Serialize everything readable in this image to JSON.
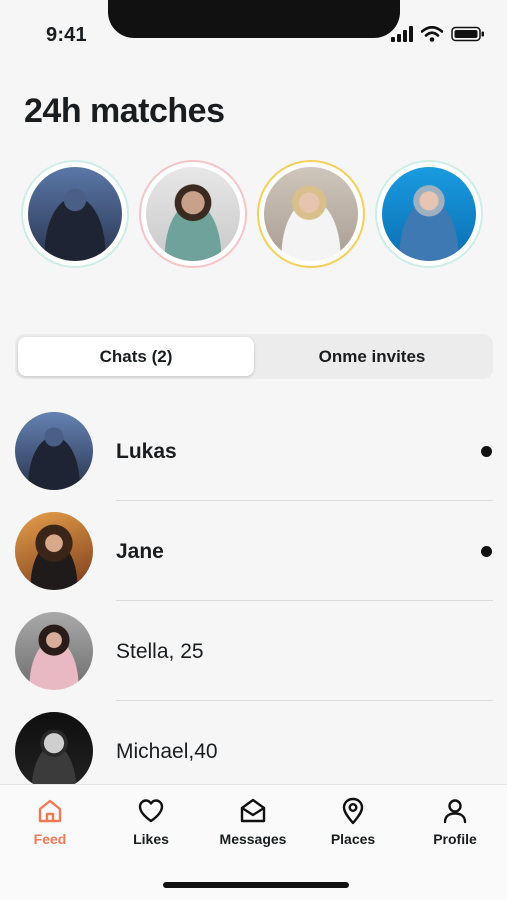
{
  "status": {
    "time": "9:41"
  },
  "title": "24h matches",
  "stories": [
    {
      "name": "story-1",
      "ring": "#cdeee6"
    },
    {
      "name": "story-2",
      "ring": "#f5c5c5"
    },
    {
      "name": "story-3",
      "ring": "#f6cf5a"
    },
    {
      "name": "story-4",
      "ring": "#cdeee6"
    }
  ],
  "tabs": {
    "chats": "Chats (2)",
    "invites": "Onme invites",
    "active": "chats"
  },
  "chats": [
    {
      "name": "Lukas",
      "unread": true
    },
    {
      "name": "Jane",
      "unread": true
    },
    {
      "name": "Stella, 25",
      "unread": false
    },
    {
      "name": "Michael,40",
      "unread": false
    }
  ],
  "nav": {
    "feed": "Feed",
    "likes": "Likes",
    "messages": "Messages",
    "places": "Places",
    "profile": "Profile",
    "active": "feed"
  },
  "colors": {
    "accent": "#f07a55",
    "background": "#f6f6f6"
  }
}
